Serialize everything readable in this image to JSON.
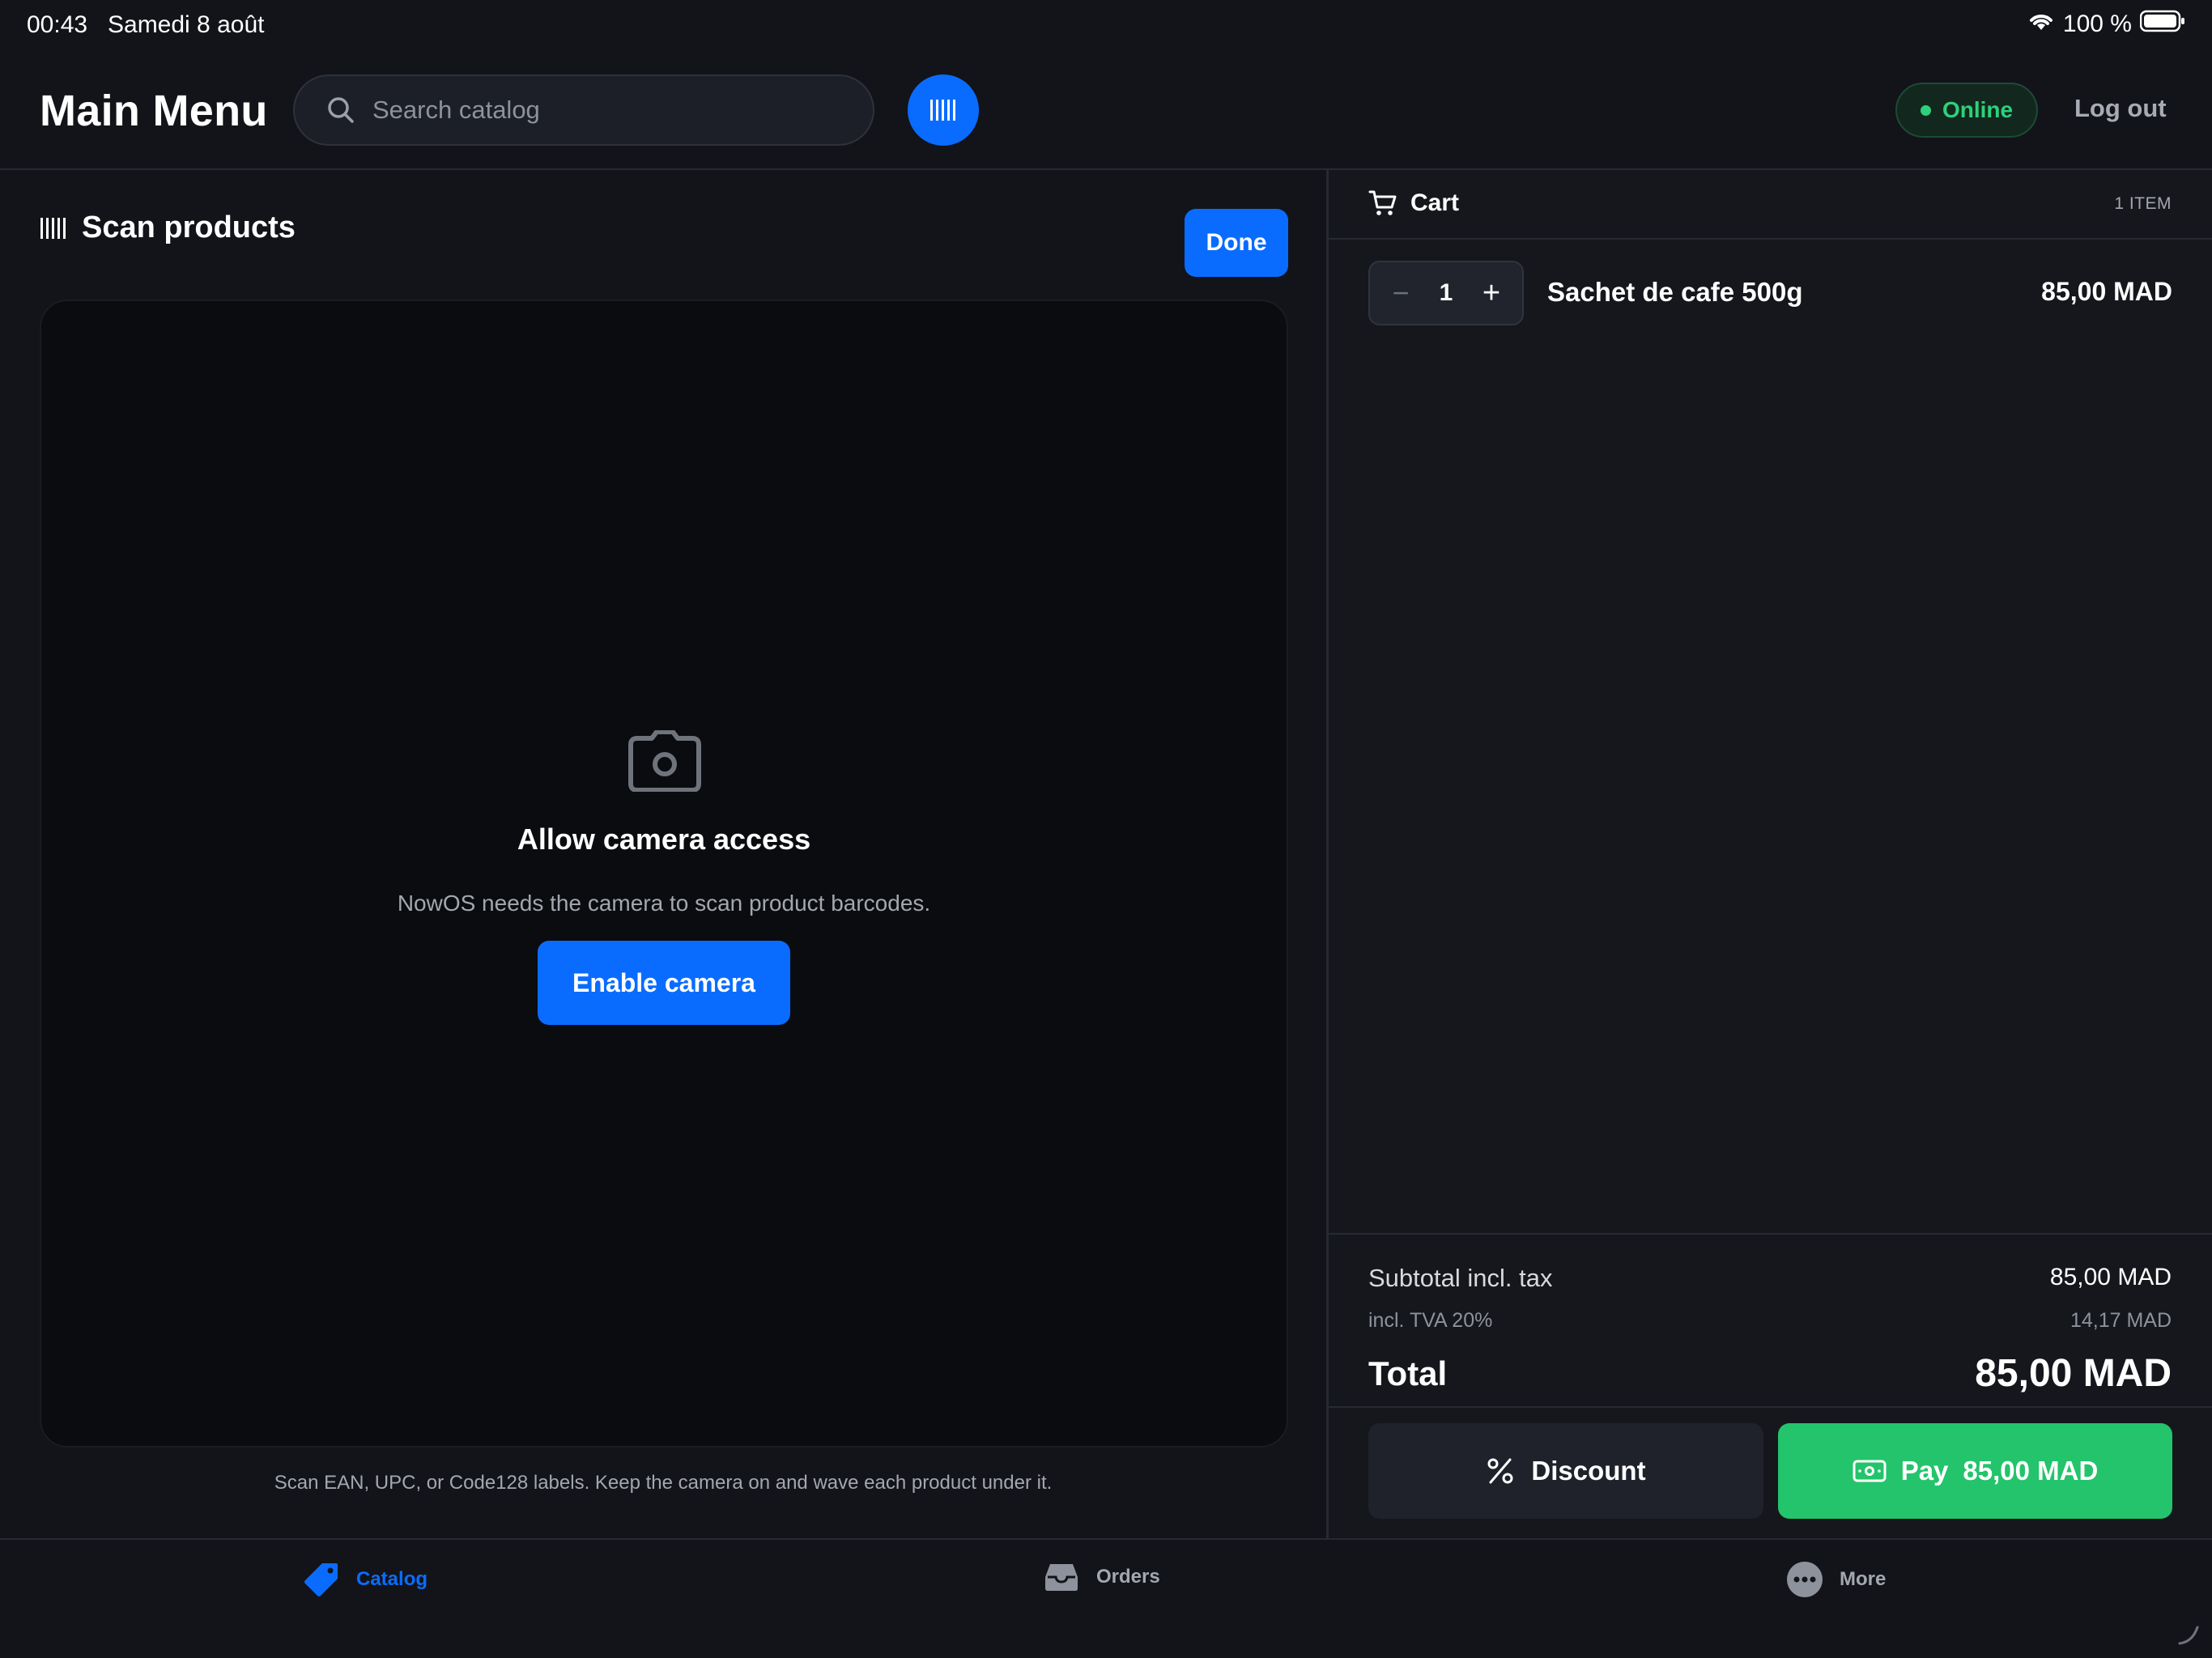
{
  "status_bar": {
    "time": "00:43",
    "date": "Samedi 8 août",
    "battery": "100 %",
    "wifi_icon": "wifi-icon",
    "battery_icon": "battery-icon"
  },
  "header": {
    "title": "Main Menu",
    "search": {
      "placeholder": "Search catalog",
      "value": ""
    },
    "scan_icon": "barcode-icon",
    "status": "Online",
    "logout_label": "Log out"
  },
  "scanner": {
    "title": "Scan products",
    "done_label": "Done",
    "camera_heading": "Allow camera access",
    "camera_description": "NowOS needs the camera to scan product barcodes.",
    "enable_label": "Enable camera",
    "hint": "Scan EAN, UPC, or Code128 labels. Keep the camera on and wave each product under it."
  },
  "cart": {
    "title": "Cart",
    "count_label": "1 ITEM",
    "items": [
      {
        "qty": "1",
        "name": "Sachet de cafe 500g",
        "price": "85,00 MAD"
      }
    ],
    "subtotal_label": "Subtotal incl. tax",
    "subtotal_value": "85,00 MAD",
    "tax_label": "incl. TVA 20%",
    "tax_value": "14,17 MAD",
    "total_label": "Total",
    "total_value": "85,00 MAD",
    "discount_label": "Discount",
    "pay_label": "Pay",
    "pay_amount": "85,00 MAD"
  },
  "tabs": [
    {
      "label": "Catalog",
      "icon": "tag-icon",
      "active": true
    },
    {
      "label": "Orders",
      "icon": "tray-icon",
      "active": false
    },
    {
      "label": "More",
      "icon": "more-icon",
      "active": false
    }
  ],
  "colors": {
    "accent": "#0a6cff",
    "success": "#23c46b",
    "online": "#2fd07a",
    "background": "#121419",
    "panel": "#15171c"
  }
}
